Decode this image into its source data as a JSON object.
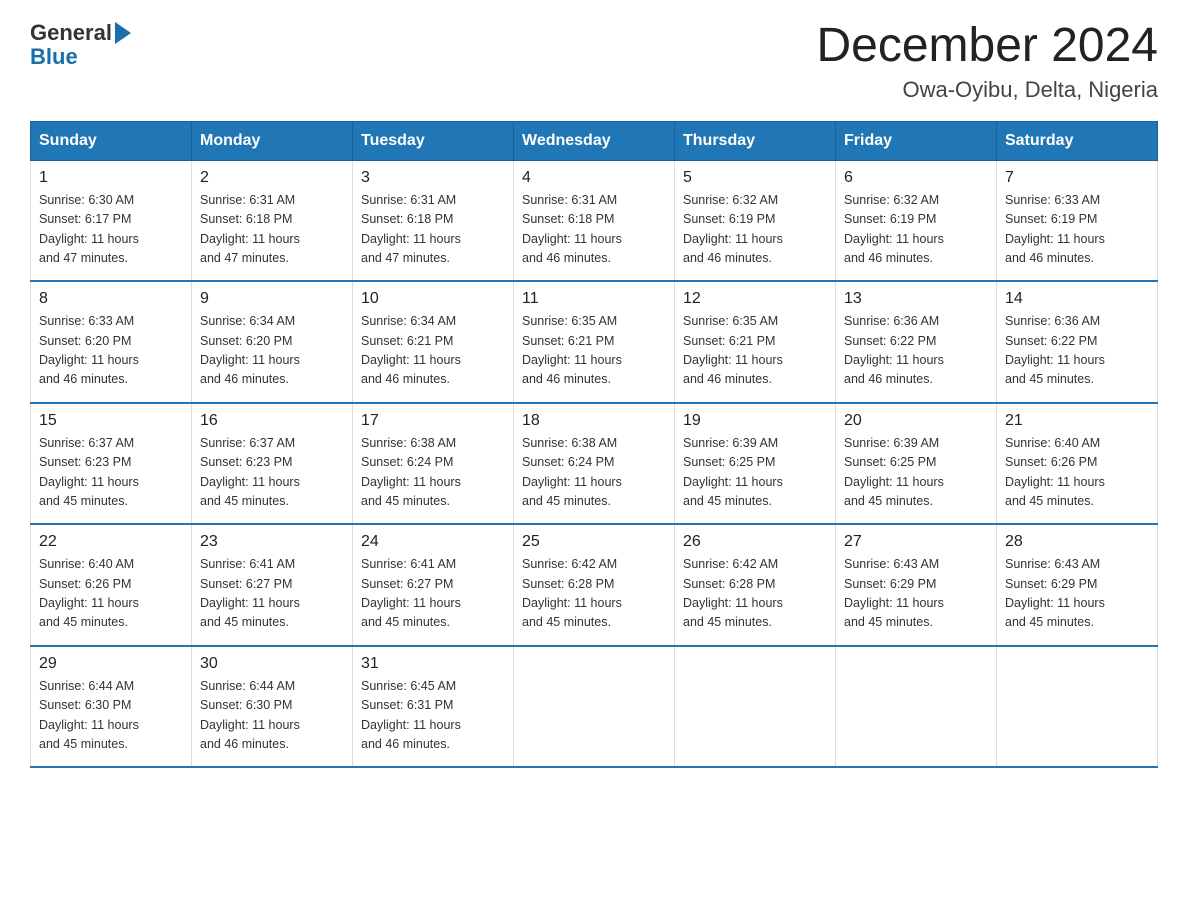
{
  "logo": {
    "general": "General",
    "blue": "Blue"
  },
  "header": {
    "month": "December 2024",
    "location": "Owa-Oyibu, Delta, Nigeria"
  },
  "weekdays": [
    "Sunday",
    "Monday",
    "Tuesday",
    "Wednesday",
    "Thursday",
    "Friday",
    "Saturday"
  ],
  "weeks": [
    [
      {
        "day": "1",
        "sunrise": "6:30 AM",
        "sunset": "6:17 PM",
        "daylight": "11 hours and 47 minutes."
      },
      {
        "day": "2",
        "sunrise": "6:31 AM",
        "sunset": "6:18 PM",
        "daylight": "11 hours and 47 minutes."
      },
      {
        "day": "3",
        "sunrise": "6:31 AM",
        "sunset": "6:18 PM",
        "daylight": "11 hours and 47 minutes."
      },
      {
        "day": "4",
        "sunrise": "6:31 AM",
        "sunset": "6:18 PM",
        "daylight": "11 hours and 46 minutes."
      },
      {
        "day": "5",
        "sunrise": "6:32 AM",
        "sunset": "6:19 PM",
        "daylight": "11 hours and 46 minutes."
      },
      {
        "day": "6",
        "sunrise": "6:32 AM",
        "sunset": "6:19 PM",
        "daylight": "11 hours and 46 minutes."
      },
      {
        "day": "7",
        "sunrise": "6:33 AM",
        "sunset": "6:19 PM",
        "daylight": "11 hours and 46 minutes."
      }
    ],
    [
      {
        "day": "8",
        "sunrise": "6:33 AM",
        "sunset": "6:20 PM",
        "daylight": "11 hours and 46 minutes."
      },
      {
        "day": "9",
        "sunrise": "6:34 AM",
        "sunset": "6:20 PM",
        "daylight": "11 hours and 46 minutes."
      },
      {
        "day": "10",
        "sunrise": "6:34 AM",
        "sunset": "6:21 PM",
        "daylight": "11 hours and 46 minutes."
      },
      {
        "day": "11",
        "sunrise": "6:35 AM",
        "sunset": "6:21 PM",
        "daylight": "11 hours and 46 minutes."
      },
      {
        "day": "12",
        "sunrise": "6:35 AM",
        "sunset": "6:21 PM",
        "daylight": "11 hours and 46 minutes."
      },
      {
        "day": "13",
        "sunrise": "6:36 AM",
        "sunset": "6:22 PM",
        "daylight": "11 hours and 46 minutes."
      },
      {
        "day": "14",
        "sunrise": "6:36 AM",
        "sunset": "6:22 PM",
        "daylight": "11 hours and 45 minutes."
      }
    ],
    [
      {
        "day": "15",
        "sunrise": "6:37 AM",
        "sunset": "6:23 PM",
        "daylight": "11 hours and 45 minutes."
      },
      {
        "day": "16",
        "sunrise": "6:37 AM",
        "sunset": "6:23 PM",
        "daylight": "11 hours and 45 minutes."
      },
      {
        "day": "17",
        "sunrise": "6:38 AM",
        "sunset": "6:24 PM",
        "daylight": "11 hours and 45 minutes."
      },
      {
        "day": "18",
        "sunrise": "6:38 AM",
        "sunset": "6:24 PM",
        "daylight": "11 hours and 45 minutes."
      },
      {
        "day": "19",
        "sunrise": "6:39 AM",
        "sunset": "6:25 PM",
        "daylight": "11 hours and 45 minutes."
      },
      {
        "day": "20",
        "sunrise": "6:39 AM",
        "sunset": "6:25 PM",
        "daylight": "11 hours and 45 minutes."
      },
      {
        "day": "21",
        "sunrise": "6:40 AM",
        "sunset": "6:26 PM",
        "daylight": "11 hours and 45 minutes."
      }
    ],
    [
      {
        "day": "22",
        "sunrise": "6:40 AM",
        "sunset": "6:26 PM",
        "daylight": "11 hours and 45 minutes."
      },
      {
        "day": "23",
        "sunrise": "6:41 AM",
        "sunset": "6:27 PM",
        "daylight": "11 hours and 45 minutes."
      },
      {
        "day": "24",
        "sunrise": "6:41 AM",
        "sunset": "6:27 PM",
        "daylight": "11 hours and 45 minutes."
      },
      {
        "day": "25",
        "sunrise": "6:42 AM",
        "sunset": "6:28 PM",
        "daylight": "11 hours and 45 minutes."
      },
      {
        "day": "26",
        "sunrise": "6:42 AM",
        "sunset": "6:28 PM",
        "daylight": "11 hours and 45 minutes."
      },
      {
        "day": "27",
        "sunrise": "6:43 AM",
        "sunset": "6:29 PM",
        "daylight": "11 hours and 45 minutes."
      },
      {
        "day": "28",
        "sunrise": "6:43 AM",
        "sunset": "6:29 PM",
        "daylight": "11 hours and 45 minutes."
      }
    ],
    [
      {
        "day": "29",
        "sunrise": "6:44 AM",
        "sunset": "6:30 PM",
        "daylight": "11 hours and 45 minutes."
      },
      {
        "day": "30",
        "sunrise": "6:44 AM",
        "sunset": "6:30 PM",
        "daylight": "11 hours and 46 minutes."
      },
      {
        "day": "31",
        "sunrise": "6:45 AM",
        "sunset": "6:31 PM",
        "daylight": "11 hours and 46 minutes."
      },
      null,
      null,
      null,
      null
    ]
  ]
}
